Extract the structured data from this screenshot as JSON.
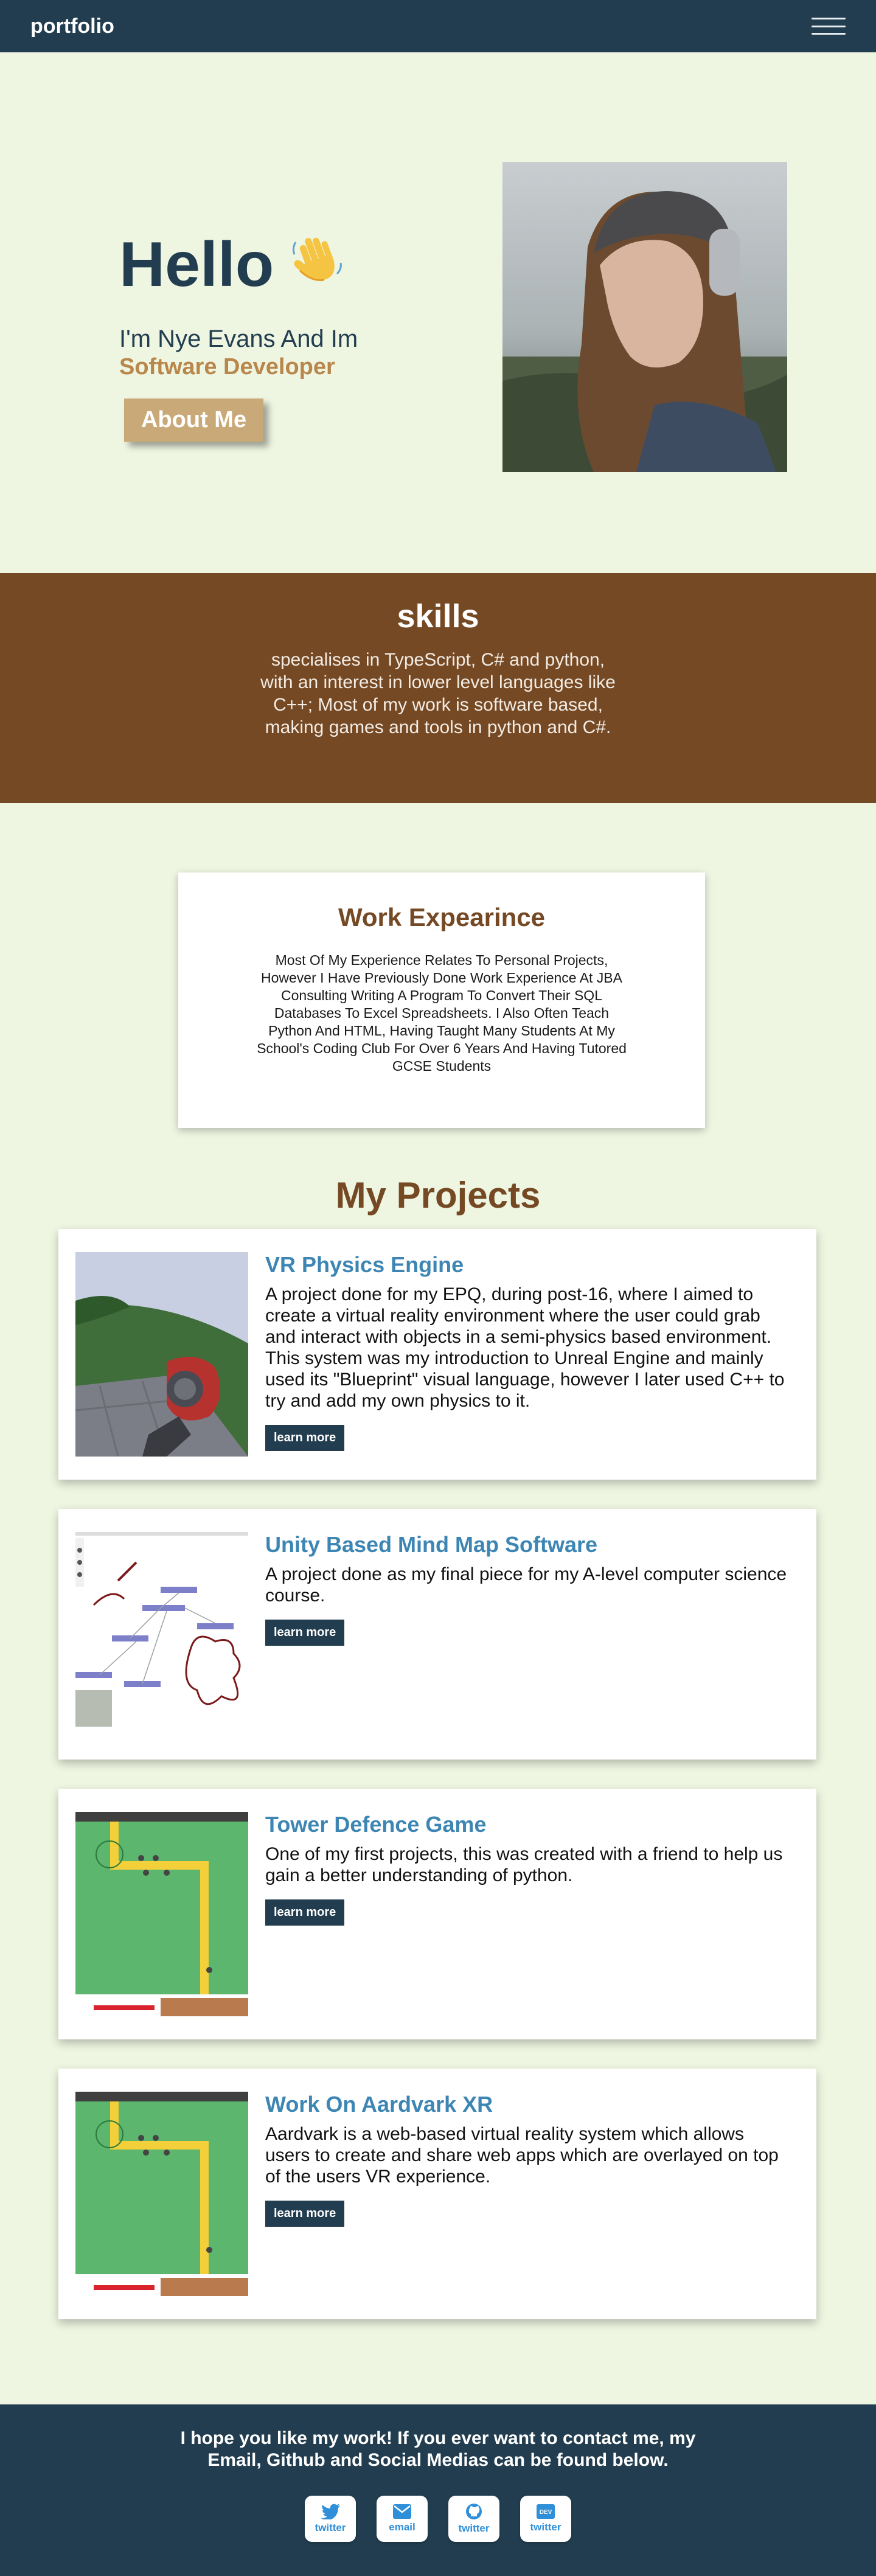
{
  "nav": {
    "brand": "portfolio",
    "menu_icon": "hamburger-icon"
  },
  "hero": {
    "greeting": "Hello",
    "wave_emoji": "👋",
    "intro": "I'm Nye Evans And Im",
    "role": "Software Developer",
    "about_button": "About Me",
    "photo_icon": "portrait-photo"
  },
  "skills": {
    "title": "skills",
    "text": "specialises in TypeScript, C# and python, with an interest in lower level languages like C++; Most of my work is software based, making games and tools in python and C#."
  },
  "work": {
    "title": "Work Expearince",
    "text": "Most Of My Experience Relates To Personal Projects, However I Have Previously Done Work Experience At JBA Consulting Writing A Program To Convert Their SQL Databases To Excel Spreadsheets. I Also Often Teach Python And HTML, Having Taught Many Students At My School's Coding Club For Over 6 Years And Having Tutored GCSE Students"
  },
  "projects": {
    "title": "My Projects",
    "items": [
      {
        "title": "VR Physics Engine",
        "description": "A project done for my EPQ, during post-16, where I aimed to create a virtual reality environment where the user could grab and interact with objects in a semi-physics based environment. This system was my introduction to Unreal Engine and mainly used its \"Blueprint\" visual language, however I later used C++ to try and add my own physics to it.",
        "button": "learn more"
      },
      {
        "title": "Unity Based Mind Map Software",
        "description": "A project done as my final piece for my A-level computer science course.",
        "button": "learn more"
      },
      {
        "title": "Tower Defence Game",
        "description": "One of my first projects, this was created with a friend to help us gain a better understanding of python.",
        "button": "learn more"
      },
      {
        "title": "Work On Aardvark XR",
        "description": "Aardvark is a web-based virtual reality system which allows users to create and share web apps which are overlayed on top of the users VR experience.",
        "button": "learn more"
      }
    ]
  },
  "footer": {
    "text": "I hope you like my work! If you ever want to contact me, my Email, Github and Social Medias can be found below.",
    "links": [
      {
        "label": "twitter",
        "icon": "twitter-icon"
      },
      {
        "label": "email",
        "icon": "email-icon"
      },
      {
        "label": "twitter",
        "icon": "github-icon"
      },
      {
        "label": "twitter",
        "icon": "dev-icon"
      }
    ]
  },
  "colors": {
    "navy": "#213d4f",
    "background": "#eef5e1",
    "brown": "#754924",
    "tan": "#c9a977",
    "gold": "#b9874b",
    "project_title_blue": "#3d86b4"
  }
}
